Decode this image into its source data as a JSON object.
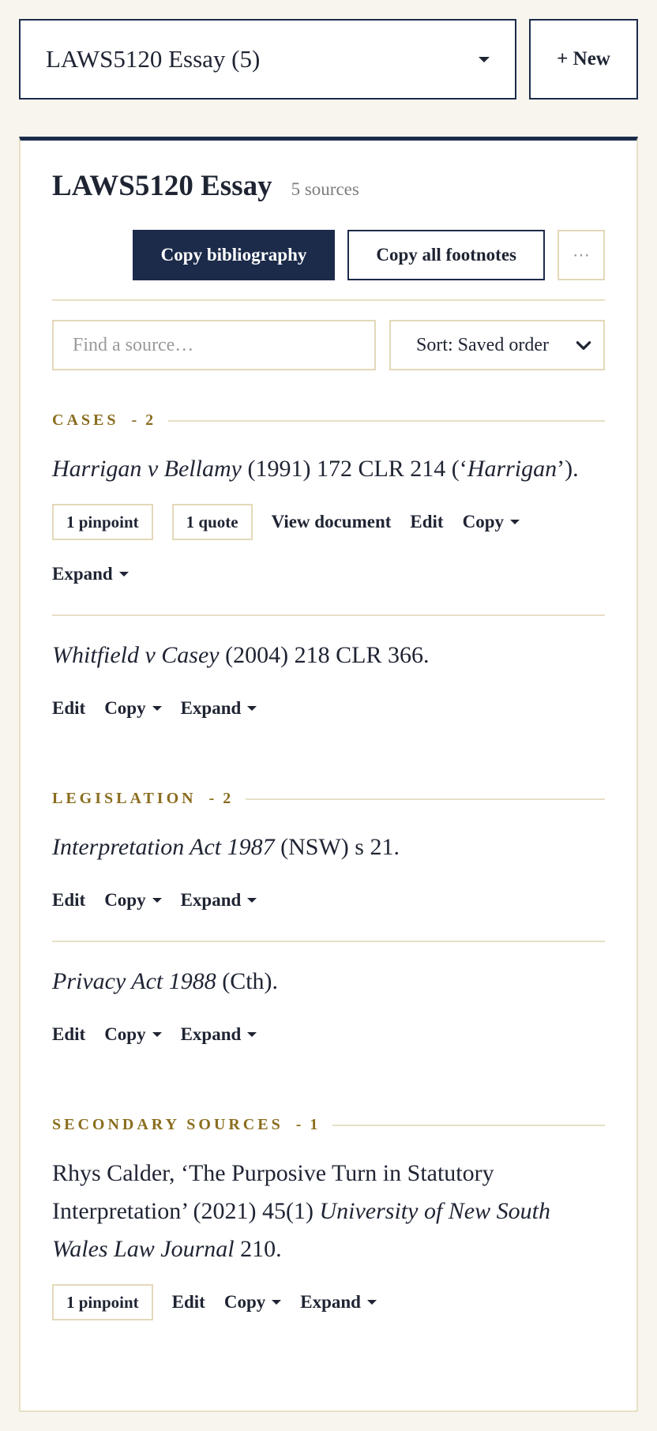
{
  "project": {
    "selected": "LAWS5120 Essay (5)",
    "new_label": "+ New"
  },
  "panel": {
    "title": "LAWS5120 Essay",
    "count": "5 sources",
    "copy_bibliography": "Copy bibliography",
    "copy_footnotes": "Copy all footnotes",
    "more": "⋯"
  },
  "filters": {
    "search_placeholder": "Find a source…",
    "sort_label": "Sort: Saved order"
  },
  "actions": {
    "view_document": "View document",
    "edit": "Edit",
    "copy": "Copy",
    "expand": "Expand"
  },
  "sections": [
    {
      "label": "CASES",
      "count": "- 2",
      "entries": [
        {
          "parts": [
            {
              "text": "Harrigan v Bellamy",
              "italic": true
            },
            {
              "text": " (1991) 172 CLR 214 (‘",
              "italic": false
            },
            {
              "text": "Harrigan",
              "italic": true
            },
            {
              "text": "’).",
              "italic": false
            }
          ],
          "pinpoint": "1 pinpoint",
          "quote": "1 quote"
        },
        {
          "parts": [
            {
              "text": "Whitfield v Casey",
              "italic": true
            },
            {
              "text": " (2004) 218 CLR 366.",
              "italic": false
            }
          ]
        }
      ]
    },
    {
      "label": "LEGISLATION",
      "count": "- 2",
      "entries": [
        {
          "parts": [
            {
              "text": "Interpretation Act 1987",
              "italic": true
            },
            {
              "text": " (NSW) s 21.",
              "italic": false
            }
          ]
        },
        {
          "parts": [
            {
              "text": "Privacy Act 1988",
              "italic": true
            },
            {
              "text": " (Cth).",
              "italic": false
            }
          ]
        }
      ]
    },
    {
      "label": "SECONDARY SOURCES",
      "count": "- 1",
      "entries": [
        {
          "parts": [
            {
              "text": "Rhys Calder, ‘The Purposive Turn in Statutory Interpretation’ (2021) 45(1) ",
              "italic": false
            },
            {
              "text": "University of New South Wales Law Journal",
              "italic": true
            },
            {
              "text": " 210.",
              "italic": false
            }
          ],
          "pinpoint": "1 pinpoint"
        }
      ]
    }
  ]
}
